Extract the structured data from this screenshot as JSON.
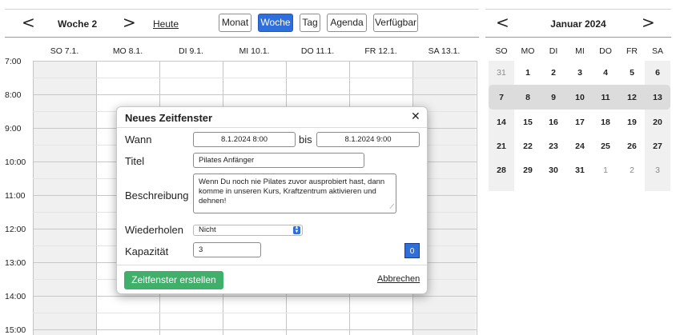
{
  "toolbar": {
    "prev_arrow": "<",
    "next_arrow": ">",
    "week_title": "Woche 2",
    "today_label": "Heute",
    "views": [
      "Monat",
      "Woche",
      "Tag",
      "Agenda",
      "Verfügbar"
    ],
    "active_view": "Woche"
  },
  "week": {
    "days": [
      "SO 7.1.",
      "MO 8.1.",
      "DI 9.1.",
      "MI 10.1.",
      "DO 11.1.",
      "FR 12.1.",
      "SA 13.1."
    ],
    "times": [
      "7:00",
      "8:00",
      "9:00",
      "10:00",
      "11:00",
      "12:00",
      "13:00",
      "14:00",
      "15:00"
    ],
    "shaded_days": [
      "SO 7.1.",
      "SA 13.1."
    ]
  },
  "minical": {
    "prev_arrow": "<",
    "next_arrow": ">",
    "title": "Januar 2024",
    "weekdays": [
      "SO",
      "MO",
      "DI",
      "MI",
      "DO",
      "FR",
      "SA"
    ],
    "weeks": [
      [
        "31",
        "1",
        "2",
        "3",
        "4",
        "5",
        "6"
      ],
      [
        "7",
        "8",
        "9",
        "10",
        "11",
        "12",
        "13"
      ],
      [
        "14",
        "15",
        "16",
        "17",
        "18",
        "19",
        "20"
      ],
      [
        "21",
        "22",
        "23",
        "24",
        "25",
        "26",
        "27"
      ],
      [
        "28",
        "29",
        "30",
        "31",
        "1",
        "2",
        "3"
      ]
    ],
    "selected_week": "7–13"
  },
  "dialog": {
    "title": "Neues Zeitfenster",
    "close": "✕",
    "when_label": "Wann",
    "start": "8.1.2024  8:00",
    "until_label": "bis",
    "end": "8.1.2024  9:00",
    "title_label": "Titel",
    "title_value": "Pilates Anfänger",
    "description_label": "Beschreibung",
    "description_value": "Wenn Du noch nie Pilates zuvor ausprobiert hast, dann komme in unseren Kurs, Kraftzentrum aktivieren und dehnen!",
    "repeat_label": "Wiederholen",
    "repeat_value": "Nicht",
    "capacity_label": "Kapazität",
    "capacity_value": "3",
    "capacity_badge": "0",
    "create_button": "Zeitfenster erstellen",
    "cancel_link": "Abbrechen"
  },
  "colors": {
    "accent": "#2f6fdc",
    "create_button": "#3faf6a",
    "weekend_shade": "#f0f0f0"
  }
}
